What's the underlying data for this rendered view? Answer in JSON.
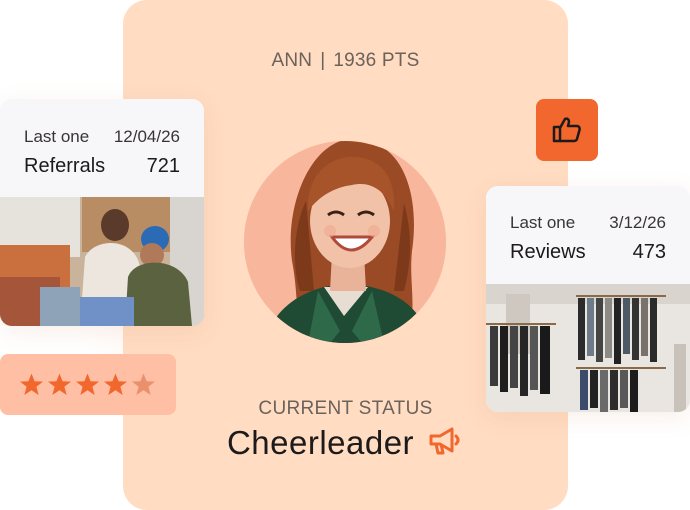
{
  "profile": {
    "name": "ANN",
    "separator": "|",
    "points": "1936 PTS"
  },
  "status": {
    "label": "CURRENT STATUS",
    "value": "Cheerleader",
    "icon": "megaphone-icon"
  },
  "action": {
    "icon": "thumbs-up-icon"
  },
  "referrals_card": {
    "last_label": "Last one",
    "last_date": "12/04/26",
    "metric": "Referrals",
    "count": "721",
    "photo": "two-people-laughing-with-laptop"
  },
  "reviews_card": {
    "last_label": "Last one",
    "last_date": "3/12/26",
    "metric": "Reviews",
    "count": "473",
    "photo": "clothing-store-rack"
  },
  "rating": {
    "value": 4,
    "max": 5,
    "icon": "star-icon"
  },
  "colors": {
    "accent": "#f2672d",
    "card_peach": "#ffdcc2",
    "rating_bg": "#ffbfa4",
    "star_filled": "#f2672d",
    "star_empty": "#e9916c"
  }
}
